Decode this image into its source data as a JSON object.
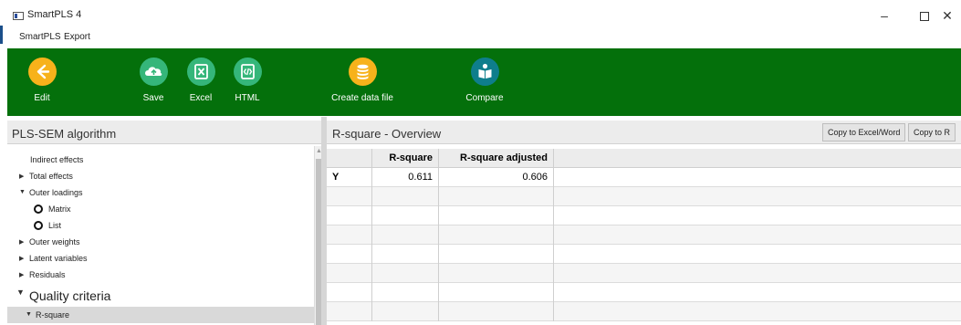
{
  "window": {
    "title": "SmartPLS 4"
  },
  "window_controls": {
    "minimize": "–",
    "maximize": "",
    "close": "✕"
  },
  "menu": {
    "items": [
      "SmartPLS",
      "Export"
    ]
  },
  "toolbar": {
    "edit": {
      "label": "Edit",
      "icon": "arrow-left-icon",
      "color": "#f7b21b"
    },
    "save": {
      "label": "Save",
      "icon": "cloud-upload-icon",
      "color": "#35b67a"
    },
    "excel": {
      "label": "Excel",
      "icon": "excel-file-icon",
      "color": "#35b67a"
    },
    "html": {
      "label": "HTML",
      "icon": "html-file-icon",
      "color": "#35b67a"
    },
    "create": {
      "label": "Create data file",
      "icon": "database-icon",
      "color": "#f7b21b"
    },
    "compare": {
      "label": "Compare",
      "icon": "compare-icon",
      "color": "#0e7e8c"
    },
    "background": "#04700b"
  },
  "left_panel": {
    "title": "PLS-SEM algorithm",
    "tree": {
      "indirect_effects": "Indirect effects",
      "total_effects": "Total effects",
      "outer_loadings": "Outer loadings",
      "matrix": "Matrix",
      "list": "List",
      "outer_weights": "Outer weights",
      "latent_variables": "Latent variables",
      "residuals": "Residuals",
      "quality_criteria": "Quality criteria",
      "r_square": "R-square"
    }
  },
  "right_panel": {
    "title": "R-square - Overview",
    "copy_excel": "Copy to Excel/Word",
    "copy_r": "Copy to R",
    "table": {
      "headers": [
        "",
        "R-square",
        "R-square adjusted"
      ],
      "rows": [
        {
          "label": "Y",
          "r_square": "0.611",
          "r_square_adjusted": "0.606"
        }
      ]
    }
  }
}
